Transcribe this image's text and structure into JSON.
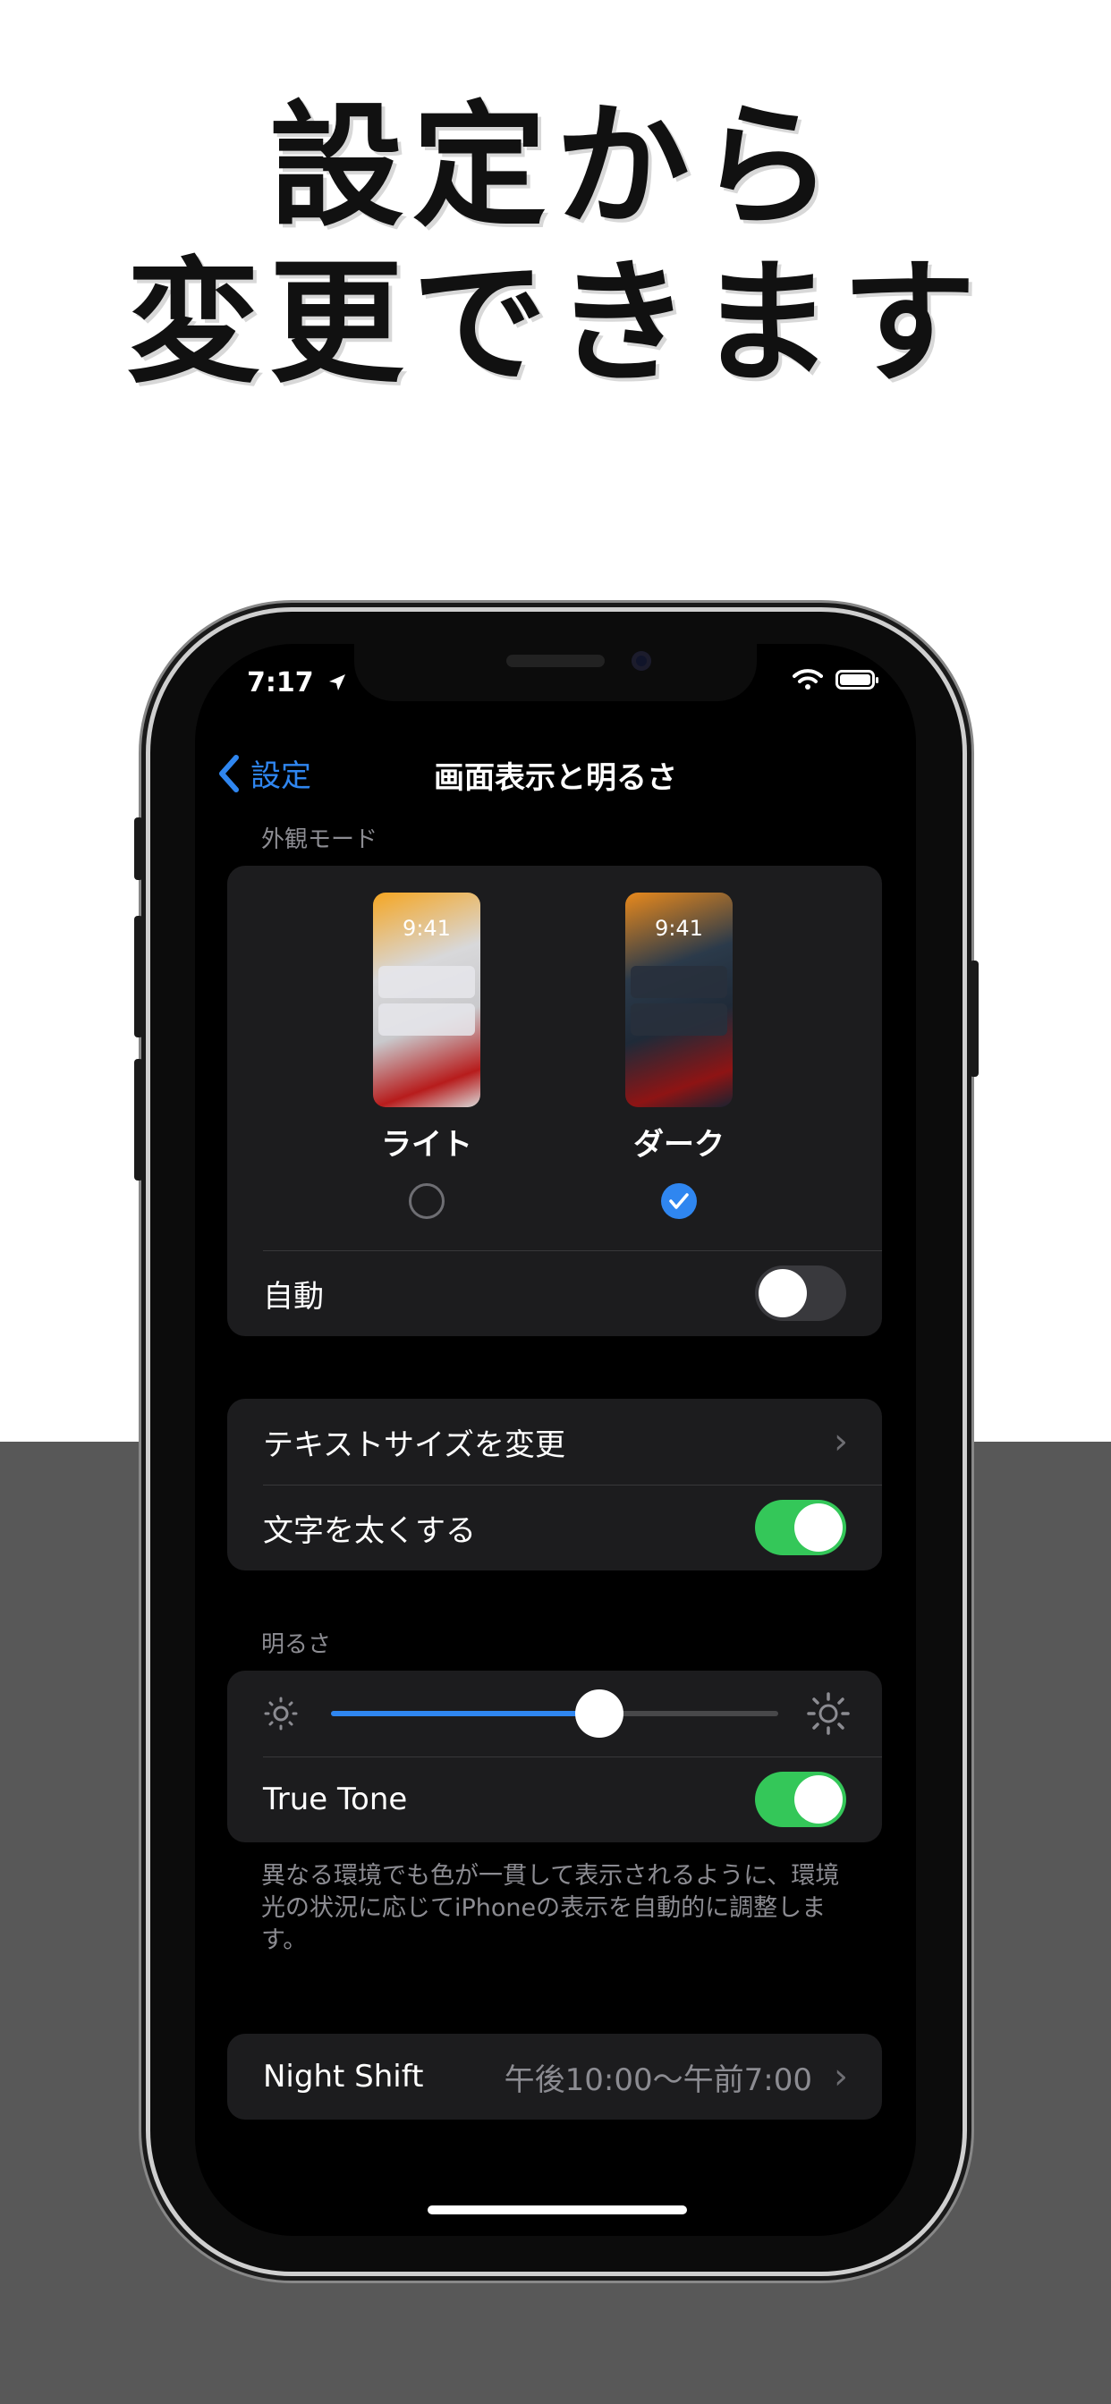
{
  "headline": {
    "line1": "設定から",
    "line2": "変更できます"
  },
  "status_bar": {
    "time": "7:17",
    "location_icon": "location-arrow-icon",
    "wifi_icon": "wifi-icon",
    "battery_icon": "battery-icon"
  },
  "nav": {
    "back_label": "設定",
    "title": "画面表示と明るさ"
  },
  "appearance": {
    "header": "外観モード",
    "options": [
      {
        "label": "ライト",
        "preview_time": "9:41",
        "selected": false
      },
      {
        "label": "ダーク",
        "preview_time": "9:41",
        "selected": true
      }
    ],
    "auto_label": "自動",
    "auto_on": false
  },
  "text_group": {
    "text_size_label": "テキストサイズを変更",
    "bold_text_label": "文字を太くする",
    "bold_text_on": true
  },
  "brightness": {
    "header": "明るさ",
    "level_percent": 60,
    "true_tone_label": "True Tone",
    "true_tone_on": true,
    "footnote": "異なる環境でも色が一貫して表示されるように、環境光の状況に応じてiPhoneの表示を自動的に調整します。"
  },
  "night_shift": {
    "label": "Night Shift",
    "value": "午後10:00〜午前7:00"
  },
  "colors": {
    "accent": "#2f86f0",
    "toggle_on": "#34c759",
    "background": "#000000",
    "card": "#1c1c1e",
    "bottom_band": "#585858"
  }
}
